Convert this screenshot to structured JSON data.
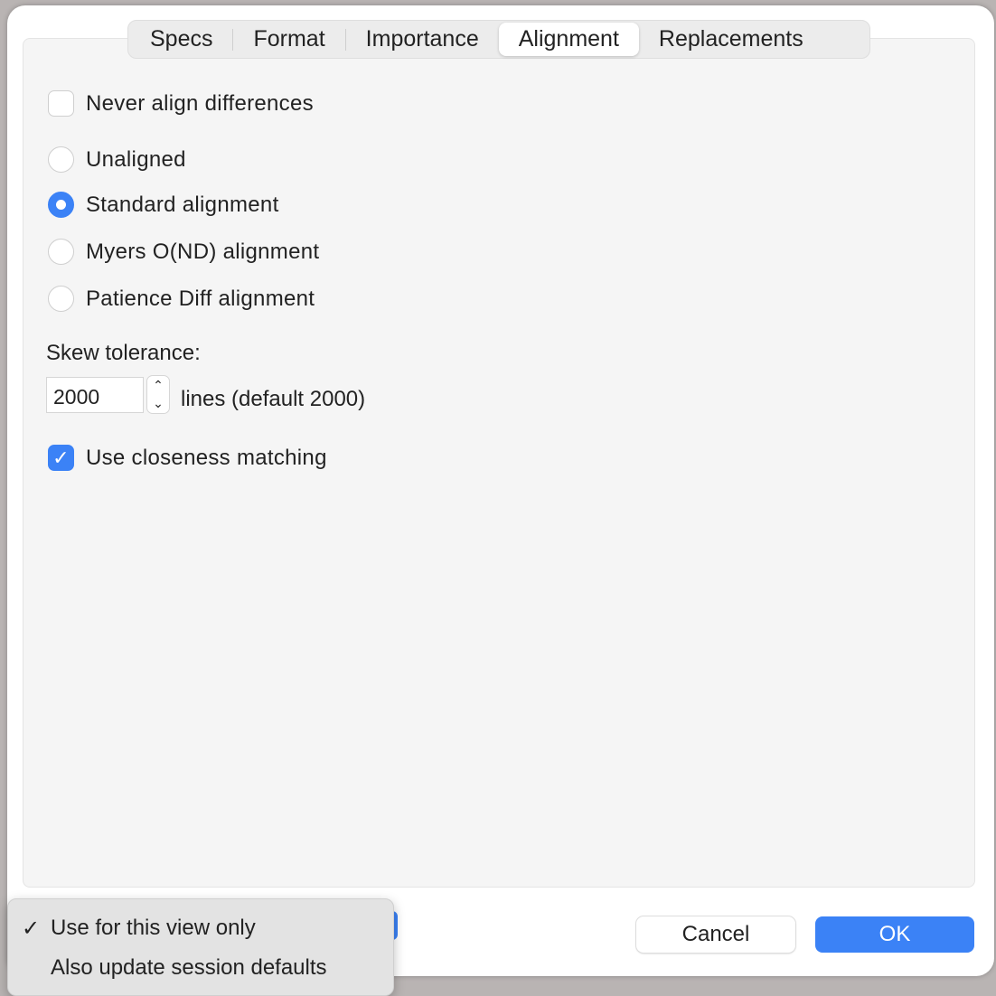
{
  "tabs": [
    "Specs",
    "Format",
    "Importance",
    "Alignment",
    "Replacements"
  ],
  "active_tab": "Alignment",
  "never_align": {
    "label": "Never align differences",
    "checked": false
  },
  "alignment_options": [
    {
      "label": "Unaligned",
      "selected": false
    },
    {
      "label": "Standard alignment",
      "selected": true
    },
    {
      "label": "Myers O(ND) alignment",
      "selected": false
    },
    {
      "label": "Patience Diff alignment",
      "selected": false
    }
  ],
  "skew": {
    "label": "Skew tolerance:",
    "value": "2000",
    "suffix": "lines (default 2000)"
  },
  "closeness": {
    "label": "Use closeness matching",
    "checked": true
  },
  "menu": {
    "items": [
      {
        "label": "Use for this view only",
        "checked": true
      },
      {
        "label": "Also update session defaults",
        "checked": false
      }
    ]
  },
  "buttons": {
    "cancel": "Cancel",
    "ok": "OK"
  },
  "colors": {
    "accent": "#3b82f6"
  }
}
